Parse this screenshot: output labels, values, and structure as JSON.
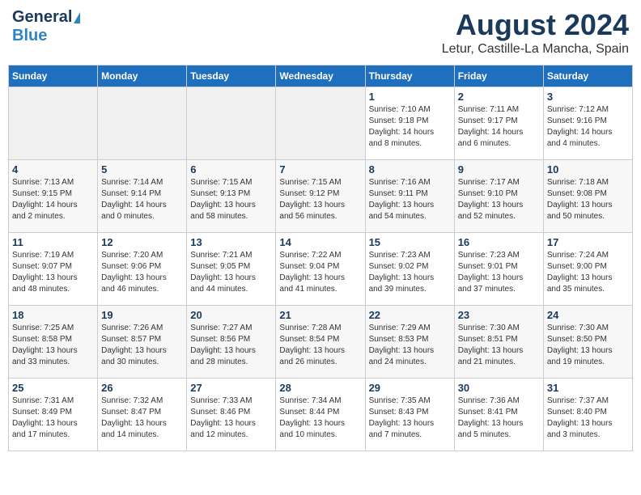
{
  "header": {
    "logo_general": "General",
    "logo_blue": "Blue",
    "month_title": "August 2024",
    "location": "Letur, Castille-La Mancha, Spain"
  },
  "weekdays": [
    "Sunday",
    "Monday",
    "Tuesday",
    "Wednesday",
    "Thursday",
    "Friday",
    "Saturday"
  ],
  "weeks": [
    [
      {
        "day": "",
        "info": ""
      },
      {
        "day": "",
        "info": ""
      },
      {
        "day": "",
        "info": ""
      },
      {
        "day": "",
        "info": ""
      },
      {
        "day": "1",
        "info": "Sunrise: 7:10 AM\nSunset: 9:18 PM\nDaylight: 14 hours\nand 8 minutes."
      },
      {
        "day": "2",
        "info": "Sunrise: 7:11 AM\nSunset: 9:17 PM\nDaylight: 14 hours\nand 6 minutes."
      },
      {
        "day": "3",
        "info": "Sunrise: 7:12 AM\nSunset: 9:16 PM\nDaylight: 14 hours\nand 4 minutes."
      }
    ],
    [
      {
        "day": "4",
        "info": "Sunrise: 7:13 AM\nSunset: 9:15 PM\nDaylight: 14 hours\nand 2 minutes."
      },
      {
        "day": "5",
        "info": "Sunrise: 7:14 AM\nSunset: 9:14 PM\nDaylight: 14 hours\nand 0 minutes."
      },
      {
        "day": "6",
        "info": "Sunrise: 7:15 AM\nSunset: 9:13 PM\nDaylight: 13 hours\nand 58 minutes."
      },
      {
        "day": "7",
        "info": "Sunrise: 7:15 AM\nSunset: 9:12 PM\nDaylight: 13 hours\nand 56 minutes."
      },
      {
        "day": "8",
        "info": "Sunrise: 7:16 AM\nSunset: 9:11 PM\nDaylight: 13 hours\nand 54 minutes."
      },
      {
        "day": "9",
        "info": "Sunrise: 7:17 AM\nSunset: 9:10 PM\nDaylight: 13 hours\nand 52 minutes."
      },
      {
        "day": "10",
        "info": "Sunrise: 7:18 AM\nSunset: 9:08 PM\nDaylight: 13 hours\nand 50 minutes."
      }
    ],
    [
      {
        "day": "11",
        "info": "Sunrise: 7:19 AM\nSunset: 9:07 PM\nDaylight: 13 hours\nand 48 minutes."
      },
      {
        "day": "12",
        "info": "Sunrise: 7:20 AM\nSunset: 9:06 PM\nDaylight: 13 hours\nand 46 minutes."
      },
      {
        "day": "13",
        "info": "Sunrise: 7:21 AM\nSunset: 9:05 PM\nDaylight: 13 hours\nand 44 minutes."
      },
      {
        "day": "14",
        "info": "Sunrise: 7:22 AM\nSunset: 9:04 PM\nDaylight: 13 hours\nand 41 minutes."
      },
      {
        "day": "15",
        "info": "Sunrise: 7:23 AM\nSunset: 9:02 PM\nDaylight: 13 hours\nand 39 minutes."
      },
      {
        "day": "16",
        "info": "Sunrise: 7:23 AM\nSunset: 9:01 PM\nDaylight: 13 hours\nand 37 minutes."
      },
      {
        "day": "17",
        "info": "Sunrise: 7:24 AM\nSunset: 9:00 PM\nDaylight: 13 hours\nand 35 minutes."
      }
    ],
    [
      {
        "day": "18",
        "info": "Sunrise: 7:25 AM\nSunset: 8:58 PM\nDaylight: 13 hours\nand 33 minutes."
      },
      {
        "day": "19",
        "info": "Sunrise: 7:26 AM\nSunset: 8:57 PM\nDaylight: 13 hours\nand 30 minutes."
      },
      {
        "day": "20",
        "info": "Sunrise: 7:27 AM\nSunset: 8:56 PM\nDaylight: 13 hours\nand 28 minutes."
      },
      {
        "day": "21",
        "info": "Sunrise: 7:28 AM\nSunset: 8:54 PM\nDaylight: 13 hours\nand 26 minutes."
      },
      {
        "day": "22",
        "info": "Sunrise: 7:29 AM\nSunset: 8:53 PM\nDaylight: 13 hours\nand 24 minutes."
      },
      {
        "day": "23",
        "info": "Sunrise: 7:30 AM\nSunset: 8:51 PM\nDaylight: 13 hours\nand 21 minutes."
      },
      {
        "day": "24",
        "info": "Sunrise: 7:30 AM\nSunset: 8:50 PM\nDaylight: 13 hours\nand 19 minutes."
      }
    ],
    [
      {
        "day": "25",
        "info": "Sunrise: 7:31 AM\nSunset: 8:49 PM\nDaylight: 13 hours\nand 17 minutes."
      },
      {
        "day": "26",
        "info": "Sunrise: 7:32 AM\nSunset: 8:47 PM\nDaylight: 13 hours\nand 14 minutes."
      },
      {
        "day": "27",
        "info": "Sunrise: 7:33 AM\nSunset: 8:46 PM\nDaylight: 13 hours\nand 12 minutes."
      },
      {
        "day": "28",
        "info": "Sunrise: 7:34 AM\nSunset: 8:44 PM\nDaylight: 13 hours\nand 10 minutes."
      },
      {
        "day": "29",
        "info": "Sunrise: 7:35 AM\nSunset: 8:43 PM\nDaylight: 13 hours\nand 7 minutes."
      },
      {
        "day": "30",
        "info": "Sunrise: 7:36 AM\nSunset: 8:41 PM\nDaylight: 13 hours\nand 5 minutes."
      },
      {
        "day": "31",
        "info": "Sunrise: 7:37 AM\nSunset: 8:40 PM\nDaylight: 13 hours\nand 3 minutes."
      }
    ]
  ]
}
